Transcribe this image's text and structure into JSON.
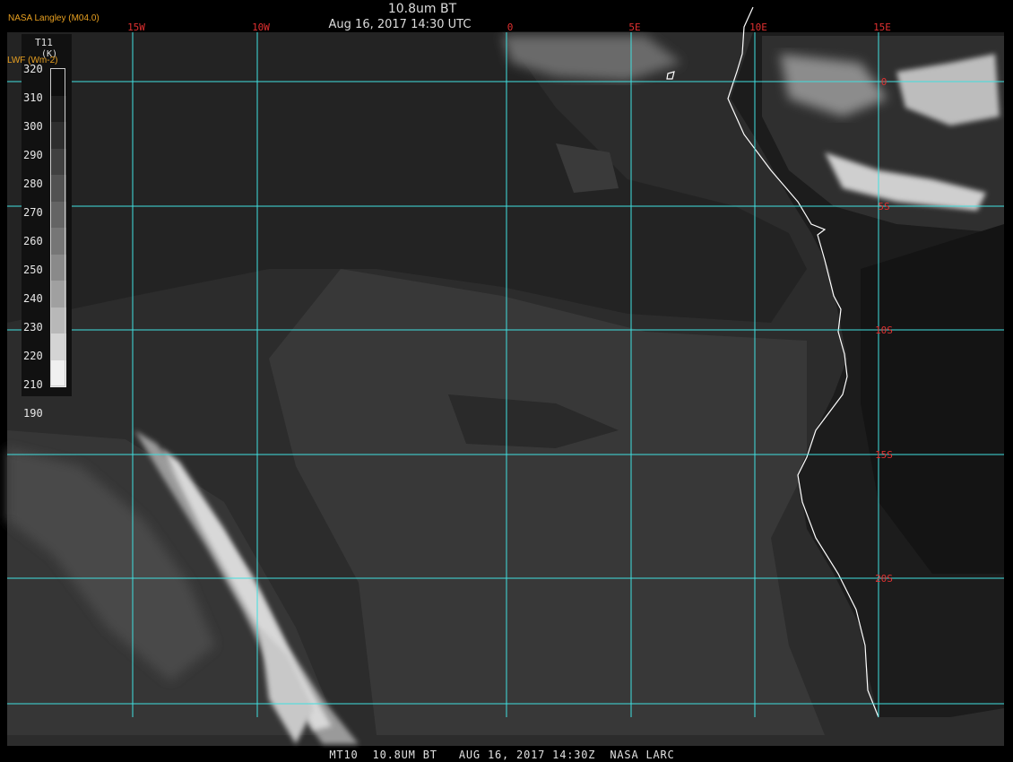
{
  "header": {
    "producer": "NASA Langley (M04.0)",
    "product": "10.8um BT",
    "datetime": "Aug 16, 2017 14:30 UTC"
  },
  "colorbar": {
    "title": "T11",
    "unit": "(K)",
    "subtitle": "LWF (Wm-2)",
    "ticks": [
      "320",
      "310",
      "300",
      "290",
      "280",
      "270",
      "260",
      "250",
      "240",
      "230",
      "220",
      "210",
      "190"
    ],
    "grays": [
      "#0e0e0e",
      "#1e1e1e",
      "#2e2e2e",
      "#404040",
      "#525252",
      "#646464",
      "#767676",
      "#8a8a8a",
      "#a0a0a0",
      "#b8b8b8",
      "#d4d4d4",
      "#f0f0f0"
    ]
  },
  "grid": {
    "color": "#40e0e0",
    "label_color": "#e03030",
    "longitudes": [
      "15W",
      "10W",
      "0",
      "5E",
      "10E",
      "15E"
    ],
    "latitudes": [
      "0",
      "5S",
      "10S",
      "15S",
      "20S"
    ]
  },
  "footer": {
    "text": "MT10  10.8UM BT   AUG 16, 2017 14:30Z  NASA LARC"
  }
}
